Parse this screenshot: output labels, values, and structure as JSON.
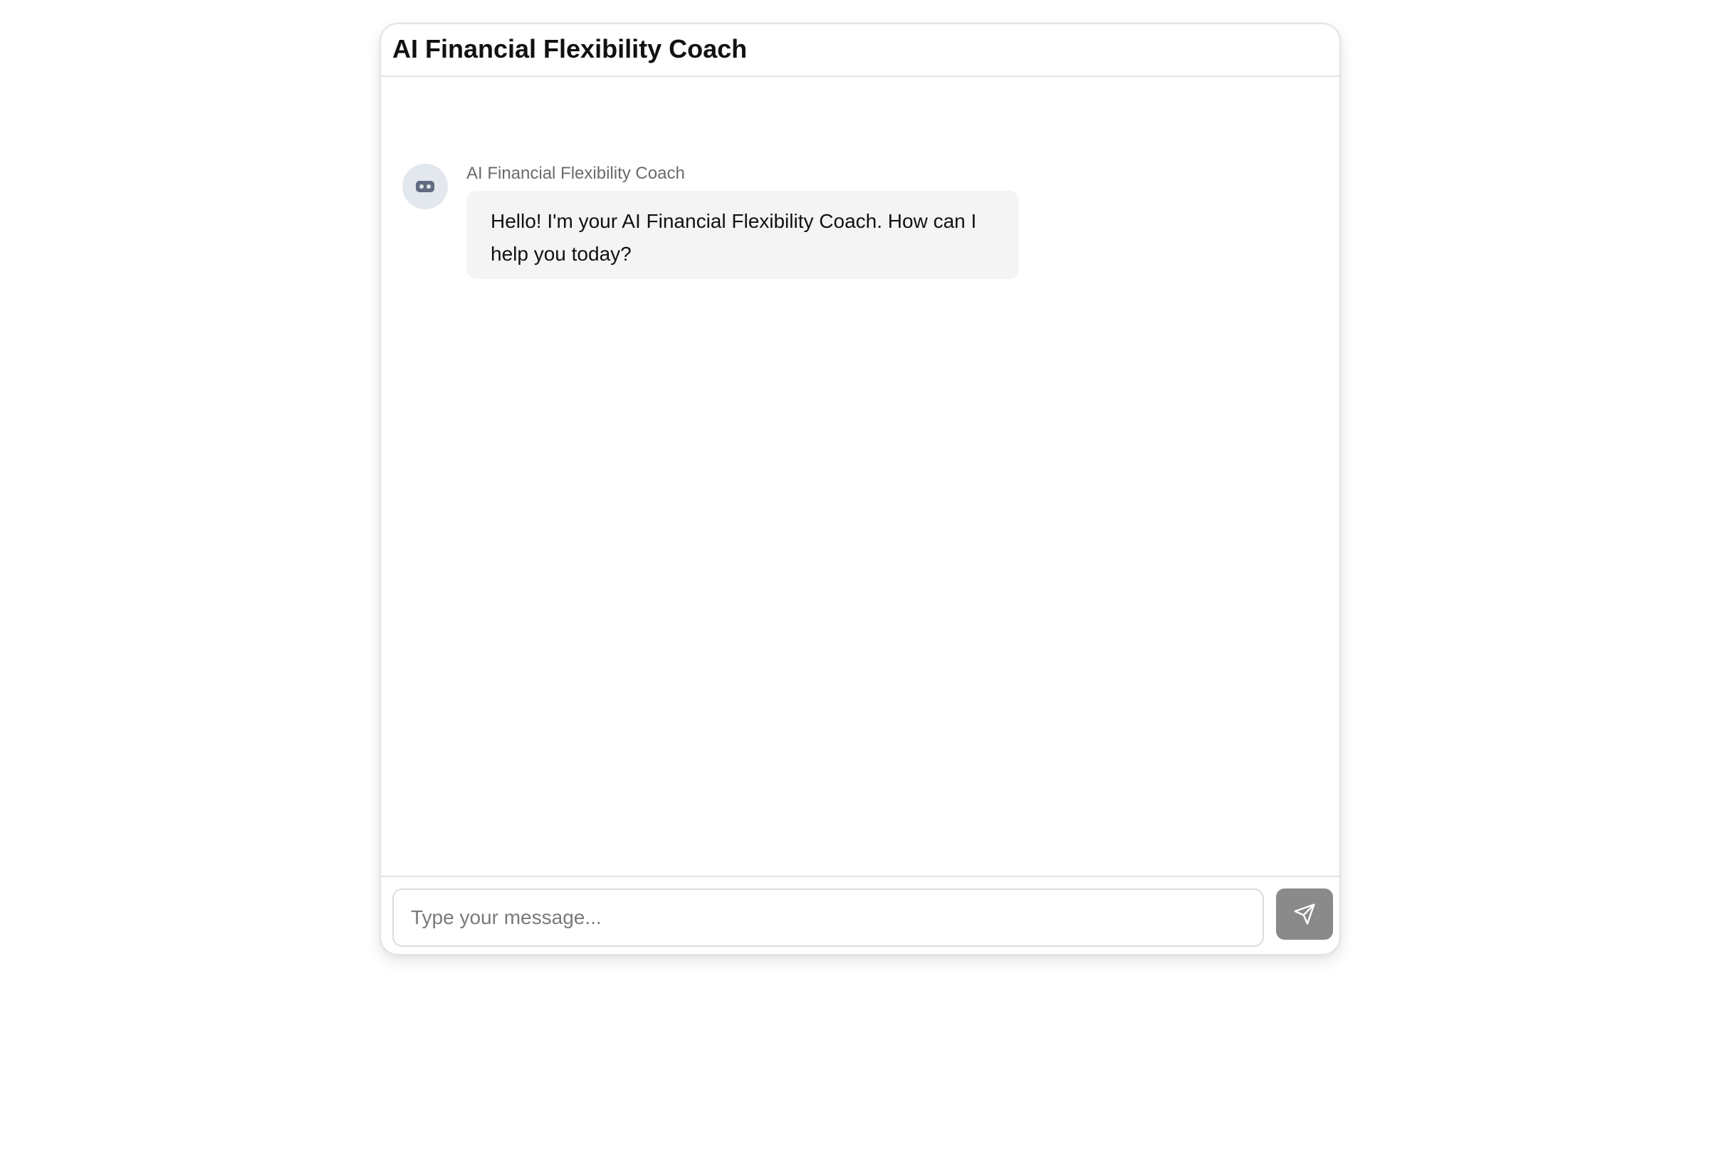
{
  "header": {
    "title": "AI Financial Flexibility Coach"
  },
  "messages": [
    {
      "sender": "AI Financial Flexibility Coach",
      "avatar_icon": "robot-icon",
      "text": "Hello! I'm your AI Financial Flexibility Coach. How can I help you today?"
    }
  ],
  "composer": {
    "placeholder": "Type your message...",
    "value": "",
    "send_icon": "send-icon"
  },
  "colors": {
    "avatar_bg": "#e3e7ee",
    "avatar_icon": "#5f6b80",
    "bubble_bg": "#f4f4f4",
    "send_button_bg": "#8a8a8a",
    "border": "#e3e3e6"
  }
}
